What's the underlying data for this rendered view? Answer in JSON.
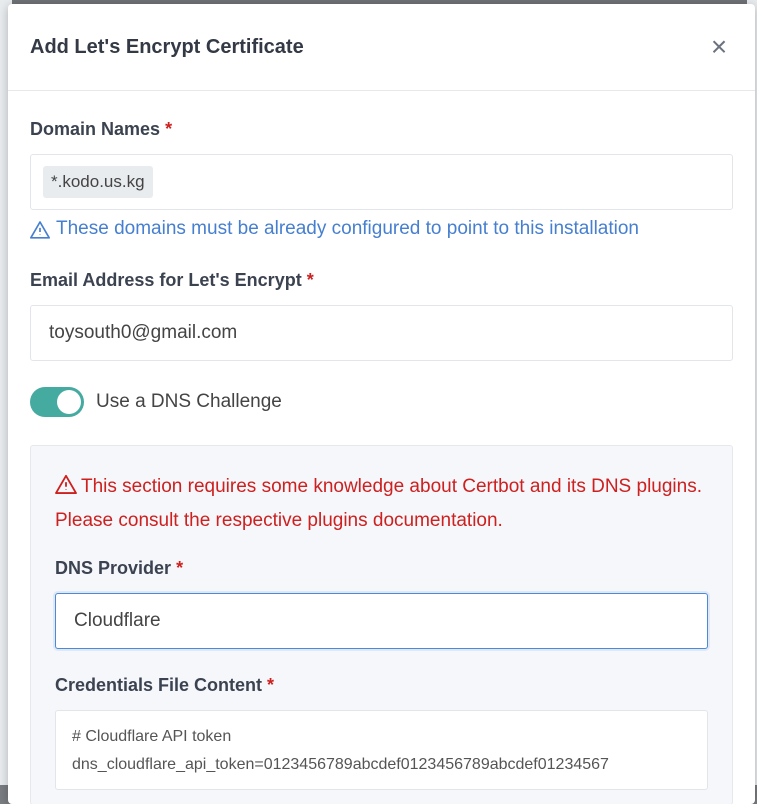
{
  "modal": {
    "title": "Add Let's Encrypt Certificate",
    "close_label": "×"
  },
  "domain_names": {
    "label": "Domain Names",
    "required_mark": "*",
    "tags": [
      "*.kodo.us.kg"
    ],
    "help_text": "These domains must be already configured to point to this installation"
  },
  "email": {
    "label": "Email Address for Let's Encrypt",
    "required_mark": "*",
    "value": "toysouth0@gmail.com"
  },
  "dns_challenge": {
    "label": "Use a DNS Challenge",
    "enabled": true
  },
  "dns_section": {
    "warning": "This section requires some knowledge about Certbot and its DNS plugins. Please consult the respective plugins documentation.",
    "provider_label": "DNS Provider",
    "provider_required": "*",
    "provider_value": "Cloudflare",
    "credentials_label": "Credentials File Content",
    "credentials_required": "*",
    "credentials_lines": [
      "# Cloudflare API token",
      "dns_cloudflare_api_token=0123456789abcdef0123456789abcdef01234567"
    ]
  },
  "colors": {
    "accent": "#467fcf",
    "danger": "#cd201f",
    "toggle_on": "#45aaa0"
  }
}
